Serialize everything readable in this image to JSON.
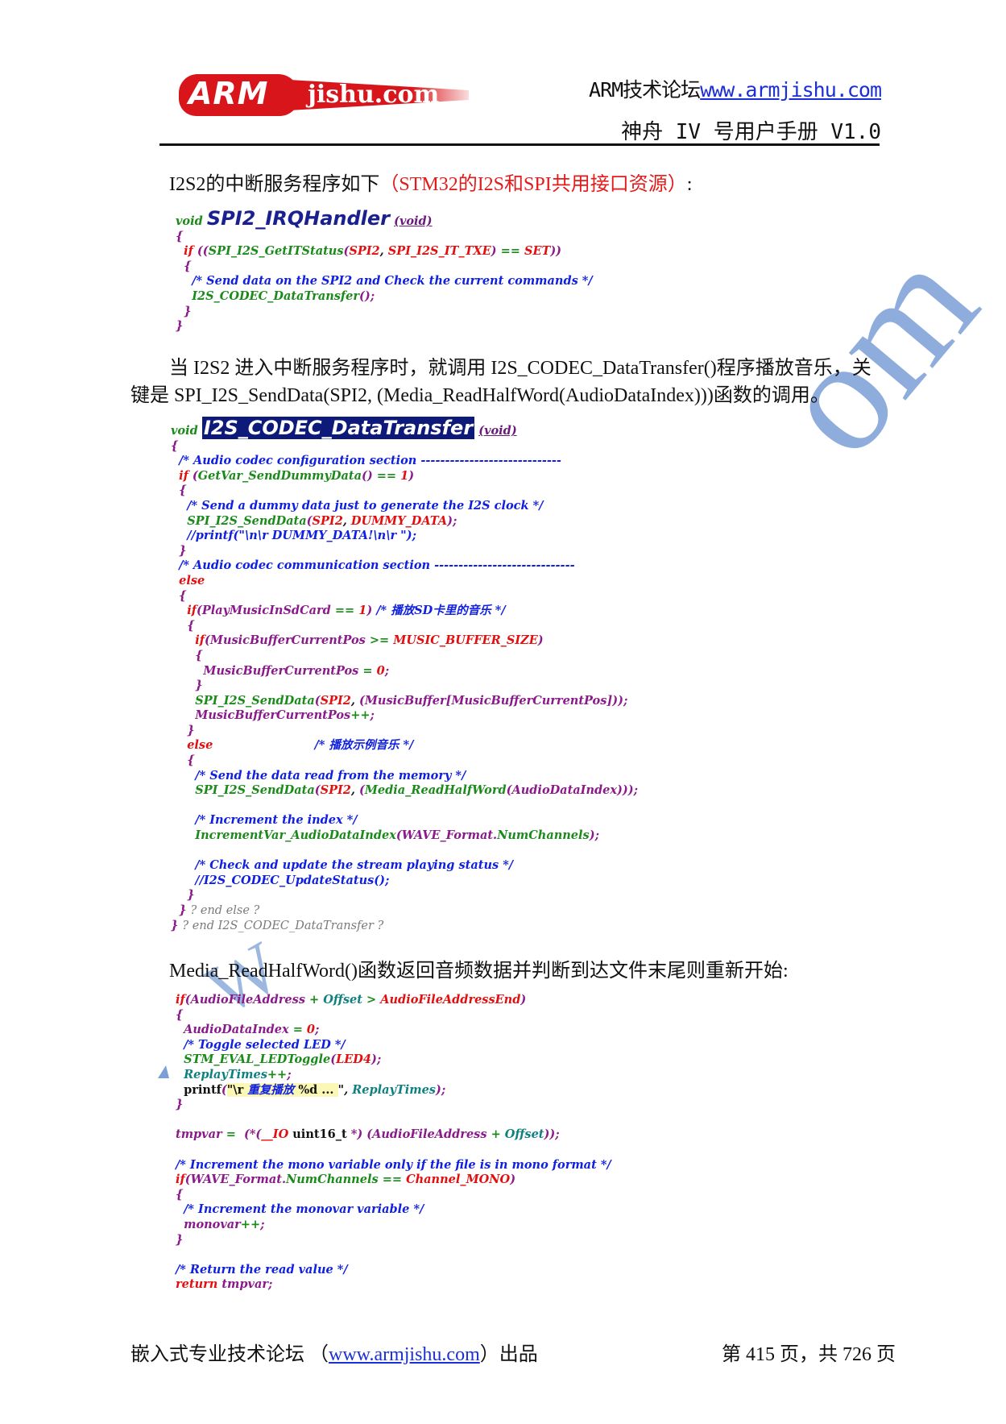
{
  "header": {
    "logo": {
      "arm": "ARM",
      "jishu": "jishu.com"
    },
    "forum_label": "ARM技术论坛",
    "forum_url": "www.armjishu.com",
    "manual_title": "神舟 IV 号用户手册 V1.0"
  },
  "paragraphs": {
    "p1_prefix": "I2S2的中断服务程序如下",
    "p1_red": "（STM32的I2S和SPI共用接口资源）",
    "p1_suffix": ":",
    "p2_line1": "当 I2S2 进入中断服务程序时，就调用 I2S_CODEC_DataTransfer()程序播放音乐，关",
    "p2_line2": "键是 SPI_I2S_SendData(SPI2, (Media_ReadHalfWord(AudioDataIndex)))函数的调用。",
    "p3": "Media_ReadHalfWord()函数返回音频数据并判断到达文件末尾则重新开始:"
  },
  "code_blocks": {
    "irq_handler": {
      "return_type": "void",
      "name": "SPI2_IRQHandler",
      "params": "(void)",
      "lines": [
        "{",
        "  if ((SPI_I2S_GetITStatus(SPI2, SPI_I2S_IT_TXE) == SET))",
        "  {",
        "    /* Send data on the SPI2 and Check the current commands */",
        "    I2S_CODEC_DataTransfer();",
        "  }",
        "}"
      ]
    },
    "data_transfer": {
      "return_type": "void",
      "name": "I2S_CODEC_DataTransfer",
      "params": "(void)",
      "lines": [
        "{",
        "  /* Audio codec configuration section -----------------------------",
        "  if (GetVar_SendDummyData() == 1)",
        "  {",
        "    /* Send a dummy data just to generate the I2S clock */",
        "    SPI_I2S_SendData(SPI2, DUMMY_DATA);",
        "    //printf(\"\\n\\r DUMMY_DATA!\\n\\r \");",
        "  }",
        "  /* Audio codec communication section -----------------------------",
        "  else",
        "  {",
        "    if(PlayMusicInSdCard == 1) /* 播放SD卡里的音乐 */",
        "    {",
        "      if(MusicBufferCurrentPos >= MUSIC_BUFFER_SIZE)",
        "      {",
        "        MusicBufferCurrentPos = 0;",
        "      }",
        "      SPI_I2S_SendData(SPI2, (MusicBuffer[MusicBufferCurrentPos]));",
        "      MusicBufferCurrentPos++;",
        "    }",
        "    else                         /* 播放示例音乐 */",
        "    {",
        "      /* Send the data read from the memory */",
        "      SPI_I2S_SendData(SPI2, (Media_ReadHalfWord(AudioDataIndex)));",
        "",
        "      /* Increment the index */",
        "      IncrementVar_AudioDataIndex(WAVE_Format.NumChannels);",
        "",
        "      /* Check and update the stream playing status */",
        "      //I2S_CODEC_UpdateStatus();",
        "    }",
        "  } ? end else ?",
        "} ? end I2S_CODEC_DataTransfer ?"
      ]
    },
    "read_half_word": {
      "lines": [
        "if(AudioFileAddress + Offset > AudioFileAddressEnd)",
        "{",
        "  AudioDataIndex = 0;",
        "  /* Toggle selected LED */",
        "  STM_EVAL_LEDToggle(LED4);",
        "  ReplayTimes++;",
        "  printf(\"\\r 重复播放 %d ... \", ReplayTimes);",
        "}",
        "",
        "tmpvar =  (*(__IO uint16_t *) (AudioFileAddress + Offset));",
        "",
        "/* Increment the mono variable only if the file is in mono format */",
        "if(WAVE_Format.NumChannels == Channel_MONO)",
        "{",
        "  /* Increment the monovar variable */",
        "  monovar++;",
        "}",
        "",
        "/* Return the read value */",
        "return tmpvar;"
      ]
    }
  },
  "watermark": {
    "text_top": "om",
    "text_mid": "W"
  },
  "footer": {
    "left_prefix": "嵌入式专业技术论坛 （",
    "left_url": "www.armjishu.com",
    "left_suffix": "）出品",
    "page_info": "第 415 页，共 726 页"
  },
  "colors": {
    "keyword_red": "#e30f0f",
    "function_green": "#1a8a1a",
    "comment_blue": "#1020e0",
    "variable_purple": "#8a1a8a",
    "teal": "#0f8080",
    "link_blue": "#1b2fd6",
    "logo_red": "#d8151b",
    "watermark_blue": "#7c9fd6"
  }
}
